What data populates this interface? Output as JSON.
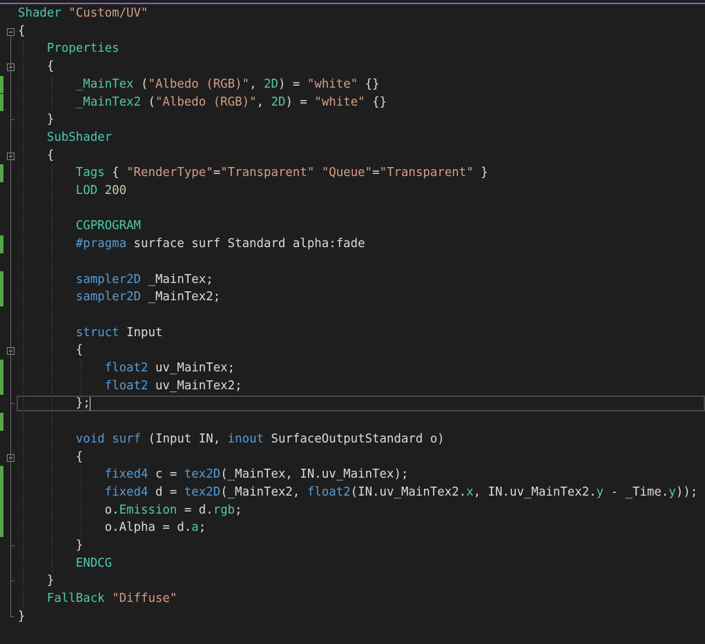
{
  "editor": {
    "language": "ShaderLab",
    "lines": [
      [
        {
          "t": "Shader ",
          "c": "teal"
        },
        {
          "t": "\"Custom/UV\"",
          "c": "str"
        }
      ],
      [
        {
          "t": "{",
          "c": "plain"
        }
      ],
      [
        {
          "t": "    Properties",
          "c": "teal"
        }
      ],
      [
        {
          "t": "    {",
          "c": "plain"
        }
      ],
      [
        {
          "t": "        ",
          "c": "plain"
        },
        {
          "t": "_MainTex",
          "c": "teal"
        },
        {
          "t": " (",
          "c": "plain"
        },
        {
          "t": "\"Albedo (RGB)\"",
          "c": "str"
        },
        {
          "t": ", ",
          "c": "plain"
        },
        {
          "t": "2D",
          "c": "teal"
        },
        {
          "t": ") = ",
          "c": "plain"
        },
        {
          "t": "\"white\"",
          "c": "str"
        },
        {
          "t": " {}",
          "c": "plain"
        }
      ],
      [
        {
          "t": "        ",
          "c": "plain"
        },
        {
          "t": "_MainTex2",
          "c": "teal"
        },
        {
          "t": " (",
          "c": "plain"
        },
        {
          "t": "\"Albedo (RGB)\"",
          "c": "str"
        },
        {
          "t": ", ",
          "c": "plain"
        },
        {
          "t": "2D",
          "c": "teal"
        },
        {
          "t": ") = ",
          "c": "plain"
        },
        {
          "t": "\"white\"",
          "c": "str"
        },
        {
          "t": " {}",
          "c": "plain"
        }
      ],
      [
        {
          "t": "    }",
          "c": "plain"
        }
      ],
      [
        {
          "t": "    SubShader",
          "c": "teal"
        }
      ],
      [
        {
          "t": "    {",
          "c": "plain"
        }
      ],
      [
        {
          "t": "        ",
          "c": "plain"
        },
        {
          "t": "Tags",
          "c": "teal"
        },
        {
          "t": " { ",
          "c": "plain"
        },
        {
          "t": "\"RenderType\"",
          "c": "str"
        },
        {
          "t": "=",
          "c": "plain"
        },
        {
          "t": "\"Transparent\"",
          "c": "str"
        },
        {
          "t": " ",
          "c": "plain"
        },
        {
          "t": "\"Queue\"",
          "c": "str"
        },
        {
          "t": "=",
          "c": "plain"
        },
        {
          "t": "\"Transparent\"",
          "c": "str"
        },
        {
          "t": " }",
          "c": "plain"
        }
      ],
      [
        {
          "t": "        ",
          "c": "plain"
        },
        {
          "t": "LOD",
          "c": "teal"
        },
        {
          "t": " ",
          "c": "plain"
        },
        {
          "t": "200",
          "c": "num"
        }
      ],
      [
        {
          "t": "",
          "c": "plain"
        }
      ],
      [
        {
          "t": "        ",
          "c": "plain"
        },
        {
          "t": "CGPROGRAM",
          "c": "teal"
        }
      ],
      [
        {
          "t": "        ",
          "c": "plain"
        },
        {
          "t": "#pragma",
          "c": "blue"
        },
        {
          "t": " surface surf Standard alpha:fade",
          "c": "plain"
        }
      ],
      [
        {
          "t": "",
          "c": "plain"
        }
      ],
      [
        {
          "t": "        ",
          "c": "plain"
        },
        {
          "t": "sampler2D",
          "c": "blue"
        },
        {
          "t": " _MainTex;",
          "c": "plain"
        }
      ],
      [
        {
          "t": "        ",
          "c": "plain"
        },
        {
          "t": "sampler2D",
          "c": "blue"
        },
        {
          "t": " _MainTex2;",
          "c": "plain"
        }
      ],
      [
        {
          "t": "",
          "c": "plain"
        }
      ],
      [
        {
          "t": "        ",
          "c": "plain"
        },
        {
          "t": "struct",
          "c": "blue"
        },
        {
          "t": " Input",
          "c": "plain"
        }
      ],
      [
        {
          "t": "        {",
          "c": "plain"
        }
      ],
      [
        {
          "t": "            ",
          "c": "plain"
        },
        {
          "t": "float2",
          "c": "blue"
        },
        {
          "t": " uv_MainTex;",
          "c": "plain"
        }
      ],
      [
        {
          "t": "            ",
          "c": "plain"
        },
        {
          "t": "float2",
          "c": "blue"
        },
        {
          "t": " uv_MainTex2;",
          "c": "plain"
        }
      ],
      [
        {
          "t": "        };",
          "c": "plain"
        }
      ],
      [
        {
          "t": "",
          "c": "plain"
        }
      ],
      [
        {
          "t": "        ",
          "c": "plain"
        },
        {
          "t": "void",
          "c": "blue"
        },
        {
          "t": " ",
          "c": "plain"
        },
        {
          "t": "surf",
          "c": "blue"
        },
        {
          "t": " (Input IN, ",
          "c": "plain"
        },
        {
          "t": "inout",
          "c": "blue"
        },
        {
          "t": " SurfaceOutputStandard o)",
          "c": "plain"
        }
      ],
      [
        {
          "t": "        {",
          "c": "plain"
        }
      ],
      [
        {
          "t": "            ",
          "c": "plain"
        },
        {
          "t": "fixed4",
          "c": "blue"
        },
        {
          "t": " c = ",
          "c": "plain"
        },
        {
          "t": "tex2D",
          "c": "blue"
        },
        {
          "t": "(_MainTex, IN.uv_MainTex);",
          "c": "plain"
        }
      ],
      [
        {
          "t": "            ",
          "c": "plain"
        },
        {
          "t": "fixed4",
          "c": "blue"
        },
        {
          "t": " d = ",
          "c": "plain"
        },
        {
          "t": "tex2D",
          "c": "blue"
        },
        {
          "t": "(_MainTex2, ",
          "c": "plain"
        },
        {
          "t": "float2",
          "c": "blue"
        },
        {
          "t": "(IN.uv_MainTex2.",
          "c": "plain"
        },
        {
          "t": "x",
          "c": "teal"
        },
        {
          "t": ", IN.uv_MainTex2.",
          "c": "plain"
        },
        {
          "t": "y",
          "c": "teal"
        },
        {
          "t": " - _Time.",
          "c": "plain"
        },
        {
          "t": "y",
          "c": "teal"
        },
        {
          "t": "));",
          "c": "plain"
        }
      ],
      [
        {
          "t": "            o.",
          "c": "plain"
        },
        {
          "t": "Emission",
          "c": "teal"
        },
        {
          "t": " = d.",
          "c": "plain"
        },
        {
          "t": "rgb",
          "c": "teal"
        },
        {
          "t": ";",
          "c": "plain"
        }
      ],
      [
        {
          "t": "            o.Alpha = d.",
          "c": "plain"
        },
        {
          "t": "a",
          "c": "teal"
        },
        {
          "t": ";",
          "c": "plain"
        }
      ],
      [
        {
          "t": "        }",
          "c": "plain"
        }
      ],
      [
        {
          "t": "        ",
          "c": "plain"
        },
        {
          "t": "ENDCG",
          "c": "teal"
        }
      ],
      [
        {
          "t": "    }",
          "c": "plain"
        }
      ],
      [
        {
          "t": "    ",
          "c": "plain"
        },
        {
          "t": "FallBack",
          "c": "teal"
        },
        {
          "t": " ",
          "c": "plain"
        },
        {
          "t": "\"Diffuse\"",
          "c": "str"
        }
      ],
      [
        {
          "t": "}",
          "c": "plain"
        }
      ]
    ],
    "changed_lines": [
      4,
      5,
      9,
      13,
      15,
      16,
      20,
      21,
      23,
      26,
      27,
      28,
      29
    ],
    "fold_markers": [
      1,
      3,
      8,
      19,
      25
    ],
    "current_line": 22
  },
  "colors": {
    "background": "#1e1e1e",
    "accent_bar": "#7b68c9",
    "change_bar": "#57a64a"
  }
}
